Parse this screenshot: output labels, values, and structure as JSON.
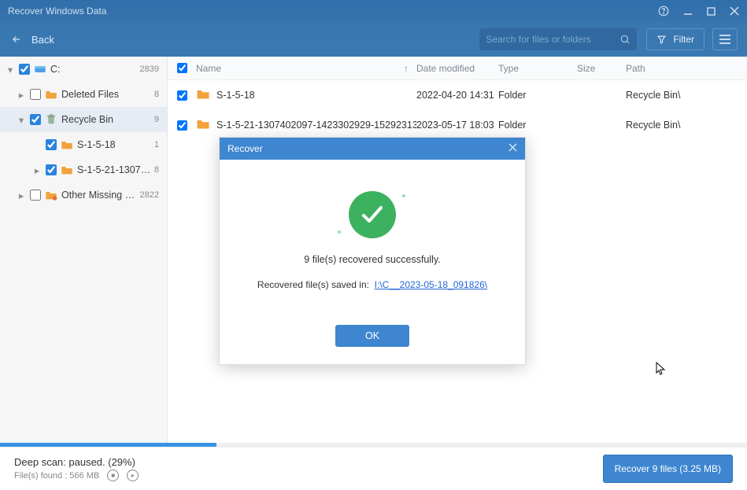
{
  "window": {
    "title": "Recover Windows Data"
  },
  "toolbar": {
    "back_label": "Back",
    "search_placeholder": "Search for files or folders",
    "filter_label": "Filter"
  },
  "sidebar": {
    "items": [
      {
        "label": "C:",
        "count": "2839",
        "indent": 1,
        "expanded": true,
        "checked": true,
        "selected": false,
        "icon": "drive"
      },
      {
        "label": "Deleted Files",
        "count": "8",
        "indent": 2,
        "expanded": false,
        "checked": false,
        "selected": false,
        "icon": "folder"
      },
      {
        "label": "Recycle Bin",
        "count": "9",
        "indent": 2,
        "expanded": true,
        "checked": true,
        "selected": true,
        "icon": "recycle"
      },
      {
        "label": "S-1-5-18",
        "count": "1",
        "indent": 3,
        "expanded": false,
        "checked": true,
        "selected": false,
        "icon": "folder",
        "leaf": true
      },
      {
        "label": "S-1-5-21-13074...",
        "count": "8",
        "indent": 3,
        "expanded": false,
        "checked": true,
        "selected": false,
        "icon": "folder"
      },
      {
        "label": "Other Missing Files",
        "count": "2822",
        "indent": 2,
        "expanded": false,
        "checked": false,
        "selected": false,
        "icon": "folder"
      }
    ]
  },
  "columns": {
    "name": "Name",
    "date": "Date modified",
    "type": "Type",
    "size": "Size",
    "path": "Path"
  },
  "rows": [
    {
      "name": "S-1-5-18",
      "date": "2022-04-20 14:31",
      "type": "Folder",
      "size": "",
      "path": "Recycle Bin\\"
    },
    {
      "name": "S-1-5-21-1307402097-1423302929-152923130...",
      "date": "2023-05-17 18:03",
      "type": "Folder",
      "size": "",
      "path": "Recycle Bin\\"
    }
  ],
  "modal": {
    "title": "Recover",
    "message": "9 file(s) recovered successfully.",
    "saved_label": "Recovered file(s) saved in:",
    "saved_path": "I:\\C__2023-05-18_091826\\",
    "ok_label": "OK"
  },
  "scan": {
    "progress_percent": 29,
    "status_text": "Deep scan: paused. (29%)",
    "found_text": "File(s) found : 566 MB"
  },
  "recover_button": "Recover 9 files (3.25 MB)"
}
